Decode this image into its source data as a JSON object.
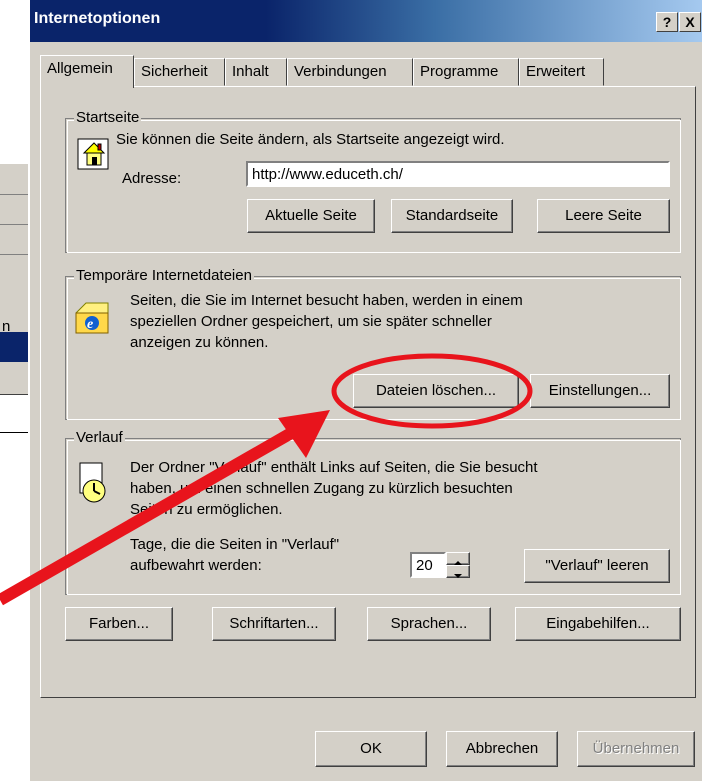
{
  "dialog": {
    "title": "Internetoptionen",
    "help_glyph": "?",
    "close_glyph": "X"
  },
  "tabs": [
    "Allgemein",
    "Sicherheit",
    "Inhalt",
    "Verbindungen",
    "Programme",
    "Erweitert"
  ],
  "background": {
    "partial_letter": "n"
  },
  "startseite": {
    "legend": "Startseite",
    "description": "Sie können die Seite ändern, als Startseite angezeigt wird.",
    "address_label": "Adresse:",
    "address_value": "http://www.educeth.ch/",
    "buttons": [
      "Aktuelle Seite",
      "Standardseite",
      "Leere Seite"
    ]
  },
  "temp": {
    "legend": "Temporäre Internetdateien",
    "line1": "Seiten, die Sie im  Internet besucht haben, werden in einem",
    "line2": "speziellen Ordner gespeichert, um sie später schneller",
    "line3": "anzeigen zu können.",
    "delete_button": "Dateien löschen...",
    "settings_button": "Einstellungen..."
  },
  "verlauf": {
    "legend": "Verlauf",
    "line1": "Der Ordner \"Verlauf\" enthält Links auf Seiten, die Sie besucht",
    "line2": "haben, um einen schnellen Zugang zu kürzlich besuchten",
    "line3": "Seiten zu ermöglichen.",
    "days_line1": "Tage, die die Seiten in \"Verlauf\"",
    "days_line2": "aufbewahrt werden:",
    "days_value": "20",
    "clear_button": "\"Verlauf\" leeren"
  },
  "bottom_buttons": [
    "Farben...",
    "Schriftarten...",
    "Sprachen...",
    "Eingabehilfen..."
  ],
  "footer": {
    "ok": "OK",
    "cancel": "Abbrechen",
    "apply": "Übernehmen"
  },
  "colors": {
    "titlebar": "#0a246a",
    "face": "#d4d0c8",
    "annotation": "#e8141c"
  }
}
